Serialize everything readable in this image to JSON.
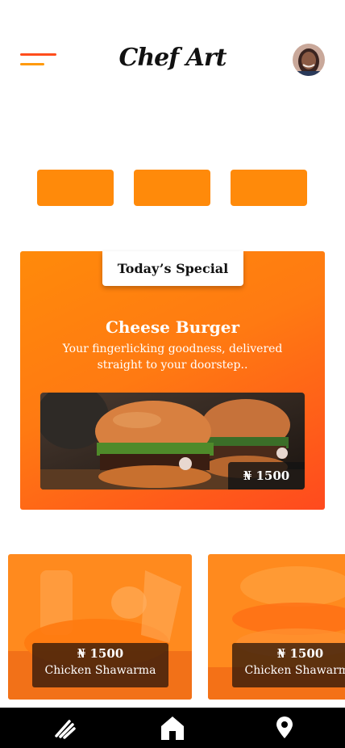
{
  "header": {
    "logo": "Chef Art",
    "menu_icon": "hamburger-menu-icon",
    "avatar_alt": "user avatar"
  },
  "categories": [
    {
      "label": ""
    },
    {
      "label": ""
    },
    {
      "label": ""
    }
  ],
  "special": {
    "tab_label": "Today’s Special",
    "name": "Cheese Burger",
    "description": "Your fingerlicking goodness, delivered straight to your doorstep..",
    "price": "₦ 1500"
  },
  "foods": [
    {
      "price": "₦ 1500",
      "name": "Chicken Shawarma"
    },
    {
      "price": "₦ 1500",
      "name": "Chicken Shawarma"
    }
  ],
  "nav": {
    "items": [
      {
        "icon": "utensils-icon"
      },
      {
        "icon": "home-icon",
        "active": true
      },
      {
        "icon": "location-pin-icon"
      }
    ]
  },
  "colors": {
    "accent": "#ff8a0a",
    "accent_deep": "#ff4a1e",
    "nav_bg": "#000000"
  }
}
